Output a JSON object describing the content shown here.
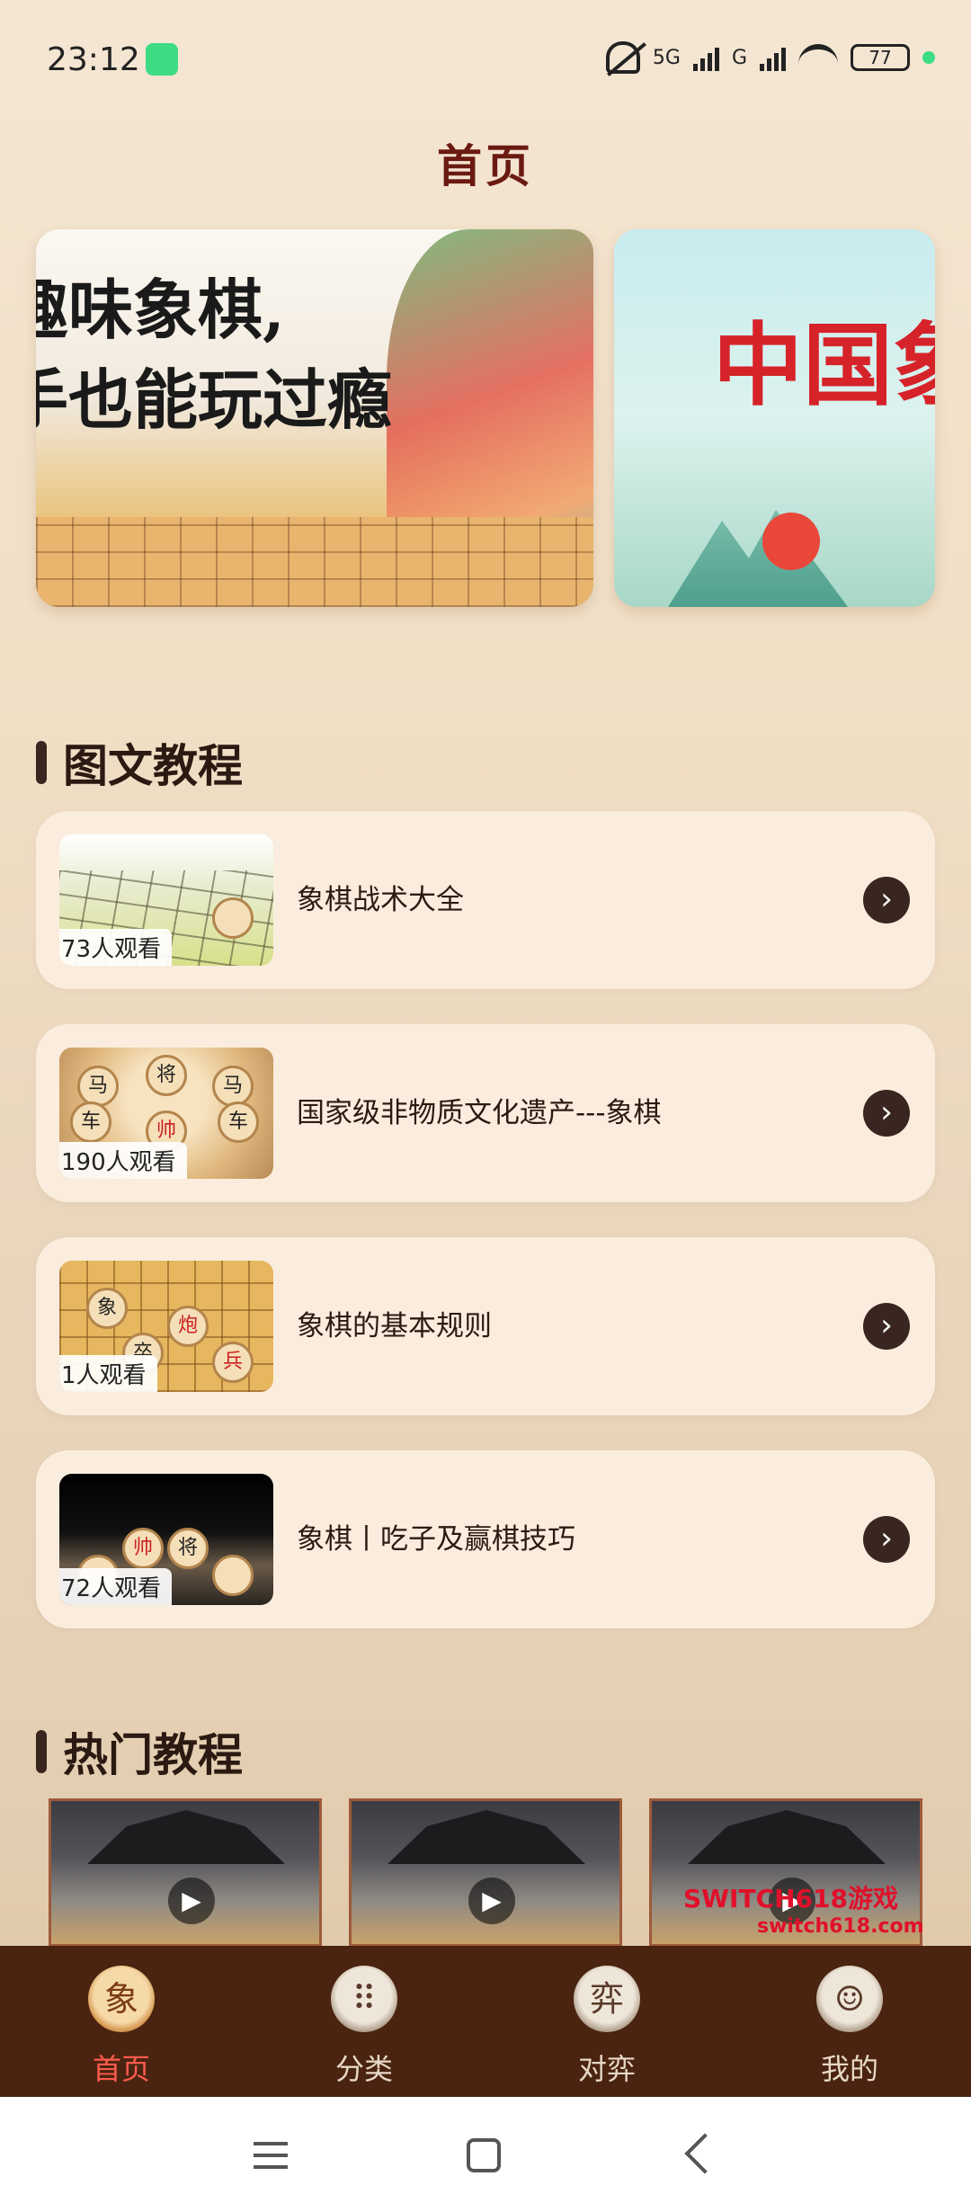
{
  "status_bar": {
    "time": "23:12",
    "network_1": "5G",
    "network_2": "G",
    "battery": "77"
  },
  "header": {
    "title": "首页"
  },
  "banners": [
    {
      "text_line1": "趣味象棋,",
      "text_line2": "手也能玩过瘾"
    },
    {
      "text": "中国象"
    }
  ],
  "section_tutorials": {
    "title": "图文教程"
  },
  "tutorials": [
    {
      "title": "象棋战术大全",
      "views": "73人观看"
    },
    {
      "title": "国家级非物质文化遗产---象棋",
      "views": "190人观看"
    },
    {
      "title": "象棋的基本规则",
      "views": "1人观看"
    },
    {
      "title": "象棋丨吃子及赢棋技巧",
      "views": "72人观看"
    }
  ],
  "section_hot": {
    "title": "热门教程"
  },
  "watermark": {
    "brand": "SWITCH618游戏",
    "url": "switch618.com"
  },
  "tabbar": {
    "items": [
      {
        "label": "首页",
        "icon_char": "象",
        "icon": "chess-piece-icon",
        "active": true
      },
      {
        "label": "分类",
        "icon_char": "⠿",
        "icon": "category-grid-icon",
        "active": false
      },
      {
        "label": "对弈",
        "icon_char": "弈",
        "icon": "versus-icon",
        "active": false
      },
      {
        "label": "我的",
        "icon_char": "☺",
        "icon": "profile-icon",
        "active": false
      }
    ]
  },
  "colors": {
    "accent": "#ff5b4d",
    "tabbar_bg": "#4a2410",
    "title": "#6b1a12",
    "card_bg": "#fbeddd"
  }
}
